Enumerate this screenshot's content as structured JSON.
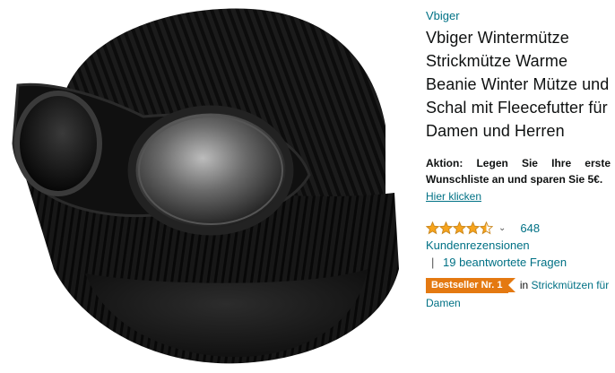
{
  "product": {
    "brand": "Vbiger",
    "title": "Vbiger Wintermütze Strickmütze Warme Beanie Winter Mütze und Schal mit Fleecefutter für Damen und Herren",
    "image_alt": "Schwarze Strickmütze mit Brillengläsern"
  },
  "promo": {
    "text": "Aktion: Legen Sie Ihre erste Wunschliste an und sparen Sie 5€.",
    "link": "Hier klicken"
  },
  "rating": {
    "stars": 4.5,
    "max": 5,
    "count": "648",
    "reviews_label": "Kundenrezensionen",
    "separator": "|",
    "answered_questions": "19 beantwortete Fragen"
  },
  "bestseller": {
    "badge": "Bestseller Nr. 1",
    "in": "in",
    "category": "Strickmützen für Damen"
  },
  "colors": {
    "link": "#007185",
    "star": "#f7a41d",
    "badge": "#e47911"
  }
}
